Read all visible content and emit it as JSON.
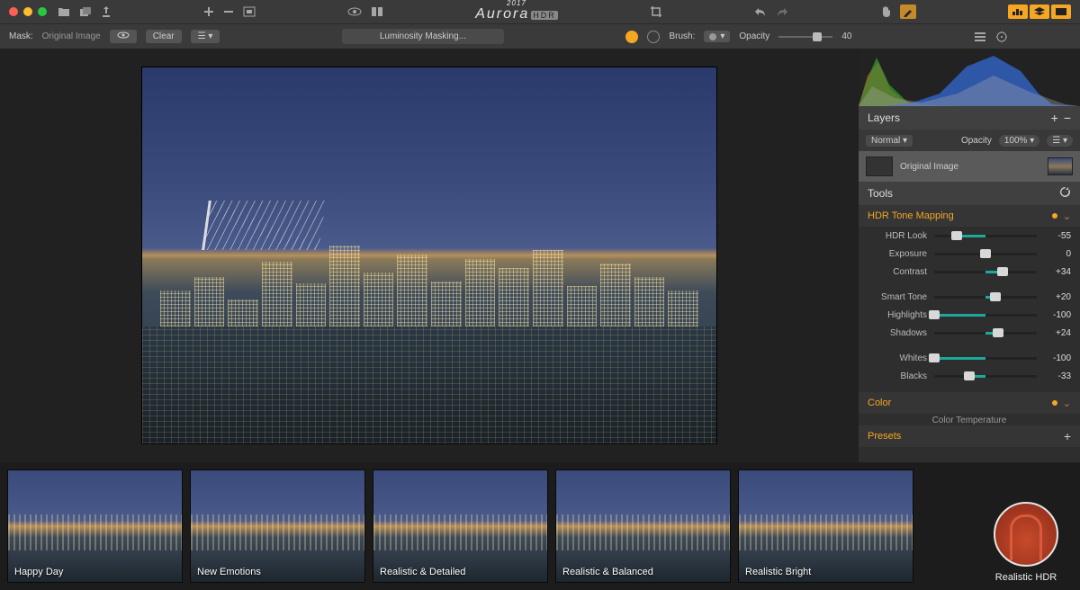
{
  "app": {
    "name": "Aurora",
    "version": "2017",
    "badge": "HDR"
  },
  "mask": {
    "label": "Mask:",
    "mode": "Original Image",
    "clear": "Clear",
    "luminosity": "Luminosity Masking...",
    "brush_label": "Brush:",
    "opacity_label": "Opacity",
    "opacity_value": "40"
  },
  "layers": {
    "title": "Layers",
    "blend": "Normal",
    "opacity_label": "Opacity",
    "opacity": "100%",
    "item": "Original Image"
  },
  "tools": {
    "title": "Tools"
  },
  "hdr": {
    "title": "HDR Tone Mapping",
    "rows": [
      {
        "label": "HDR Look",
        "value": "-55",
        "pos": 22,
        "fill_from": 22,
        "fill_to": 50
      },
      {
        "label": "Exposure",
        "value": "0",
        "pos": 50,
        "fill_from": 50,
        "fill_to": 50
      },
      {
        "label": "Contrast",
        "value": "+34",
        "pos": 67,
        "fill_from": 50,
        "fill_to": 67
      }
    ],
    "rows2": [
      {
        "label": "Smart Tone",
        "value": "+20",
        "pos": 60,
        "fill_from": 50,
        "fill_to": 60
      },
      {
        "label": "Highlights",
        "value": "-100",
        "pos": 0,
        "fill_from": 0,
        "fill_to": 50
      },
      {
        "label": "Shadows",
        "value": "+24",
        "pos": 62,
        "fill_from": 50,
        "fill_to": 62
      }
    ],
    "rows3": [
      {
        "label": "Whites",
        "value": "-100",
        "pos": 0,
        "fill_from": 0,
        "fill_to": 50
      },
      {
        "label": "Blacks",
        "value": "-33",
        "pos": 34,
        "fill_from": 34,
        "fill_to": 50
      }
    ]
  },
  "color": {
    "title": "Color",
    "sub": "Color Temperature"
  },
  "presets": {
    "title": "Presets",
    "items": [
      "Happy Day",
      "New Emotions",
      "Realistic & Detailed",
      "Realistic & Balanced",
      "Realistic Bright"
    ],
    "category": "Realistic HDR"
  }
}
